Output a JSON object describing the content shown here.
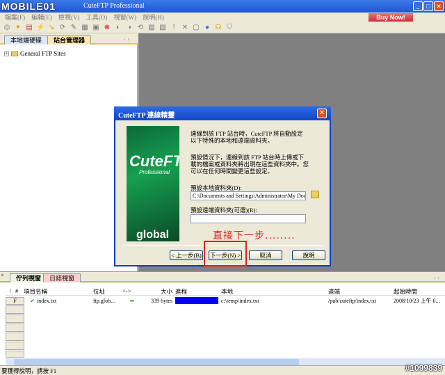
{
  "window": {
    "title": "CuteFTP Professional",
    "logo": "MOBILE01"
  },
  "menu": [
    "檔案(F)",
    "編輯(E)",
    "檢視(V)",
    "工具(O)",
    "視窗(W)",
    "說明(H)"
  ],
  "buy_now": "Buy Now!",
  "toolbar_icons": [
    "connect",
    "wizard",
    "new-site",
    "connect",
    "disconnect",
    "reconnect",
    "stop",
    "queue",
    "stop-red",
    "download",
    "upload",
    "refresh",
    "edit",
    "rename",
    "exclamation",
    "delete",
    "properties",
    "globe",
    "help",
    "shield"
  ],
  "left_tabs": [
    "本地端硬碟",
    "站台管理器"
  ],
  "tree": {
    "item": "General FTP Sites"
  },
  "dialog": {
    "title": "CuteFTP 連線精靈",
    "banner": {
      "logo": "CuteFTP",
      "sub": "Professional",
      "brand": "global"
    },
    "para1": "連線到該 FTP 站台時，CuteFTP 將自動設定以下特殊的本地和遠端資料夾。",
    "para2": "預設情況下，連線到該 FTP 站台時上傳或下載的檔案或資料夾將出現在這些資料夾中。您可以在任何時間變更這些設定。",
    "local_label": "預設本地資料夾(D):",
    "local_value": "C:\\Documents and Settings\\Administrator\\My Docu",
    "remote_label": "預設遠端資料夾(可選)(R):",
    "remote_value": "",
    "buttons": {
      "back": "< 上一步(B)",
      "next": "下一步(N) >",
      "cancel": "取消",
      "help": "說明"
    },
    "annotation": "直接下一步........"
  },
  "bottom_tabs": [
    "佇列視窗",
    "日誌視窗"
  ],
  "queue": {
    "columns": [
      "/",
      "#",
      "項目名稱",
      "位址",
      "<->",
      "大小",
      "進程",
      "本地",
      "遠端",
      "起始時間"
    ],
    "rows": [
      {
        "flag": "F",
        "name": "index.txt",
        "address": "ftp.glob...",
        "size": "339 bytes",
        "progress": 100,
        "local": "c:\\temp\\index.txt",
        "remote": "/pub/cuteftp/index.txt",
        "start": "2008/10/23 上午 0..."
      }
    ]
  },
  "status": "要獲得說明，請按 F1",
  "watermark": "#1099839",
  "colors": {
    "titlebar": "#1f55d6",
    "annotation": "#e02020",
    "progress": "#0000ff"
  }
}
